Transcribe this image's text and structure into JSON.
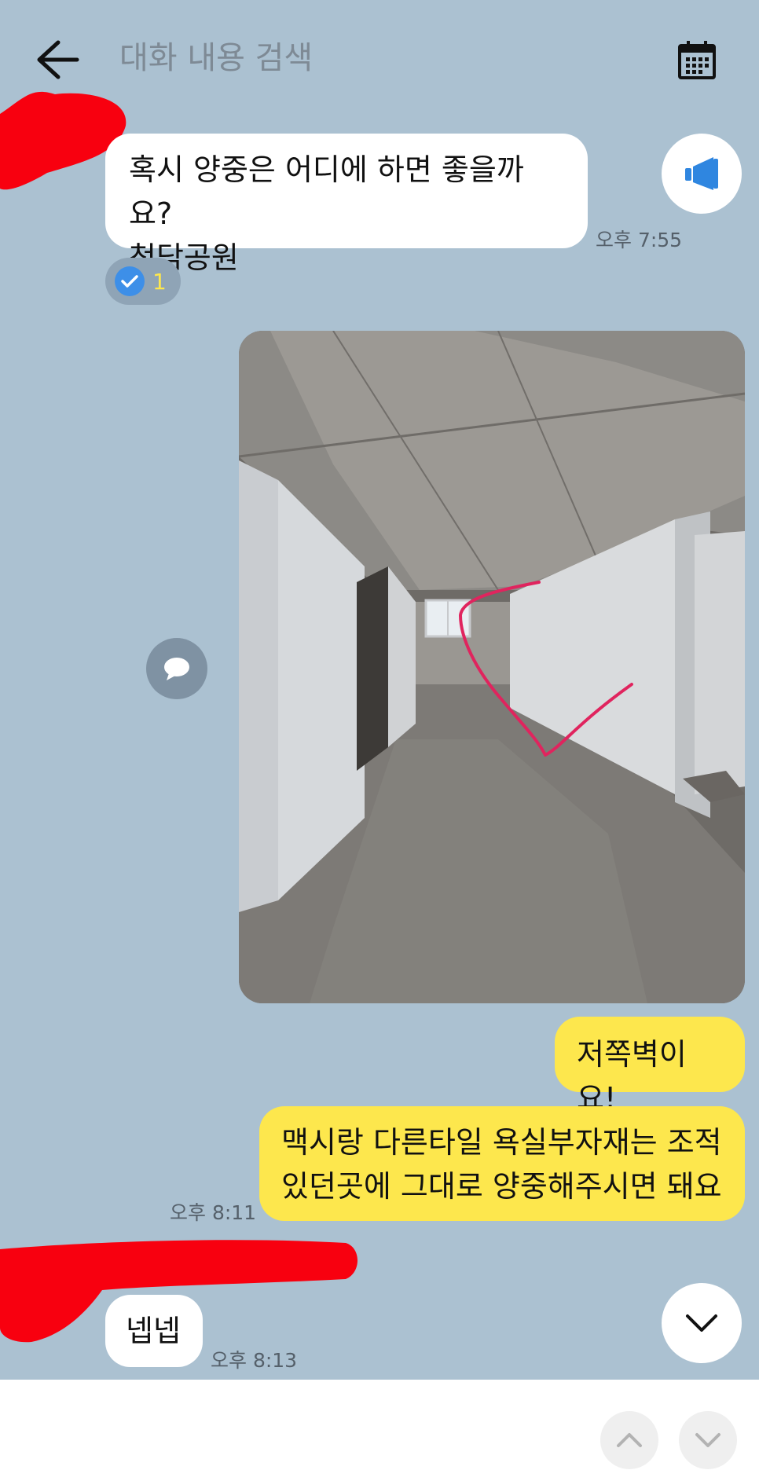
{
  "header": {
    "search_placeholder": "대화 내용 검색"
  },
  "messages": [
    {
      "sender": "other",
      "lines": [
        "혹시 양중은 어디에 하면 좋을까요?",
        "청담공원"
      ],
      "time": "오후 7:55",
      "read_count": "1"
    },
    {
      "sender": "me",
      "type": "photo"
    },
    {
      "sender": "me",
      "lines": [
        "저쪽벽이요!"
      ]
    },
    {
      "sender": "me",
      "lines": [
        "맥시랑 다른타일 욕실부자재는 조적",
        "있던곳에 그대로 양중해주시면 돼요"
      ],
      "time": "오후 8:11"
    },
    {
      "sender": "other",
      "lines": [
        "넵넵"
      ],
      "time": "오후 8:13"
    }
  ],
  "icons": {
    "back": "arrow-left-icon",
    "calendar": "calendar-icon",
    "notice": "megaphone-icon",
    "check": "check-icon",
    "comment": "speech-bubble-icon",
    "scroll_down": "chevron-down-icon",
    "prev": "chevron-up-icon",
    "next": "chevron-down-icon"
  },
  "colors": {
    "background": "#abc1d1",
    "my_bubble": "#fde74d",
    "their_bubble": "#ffffff",
    "check_badge": "#3d8fe8",
    "annotation_stroke": "#e0245e"
  }
}
